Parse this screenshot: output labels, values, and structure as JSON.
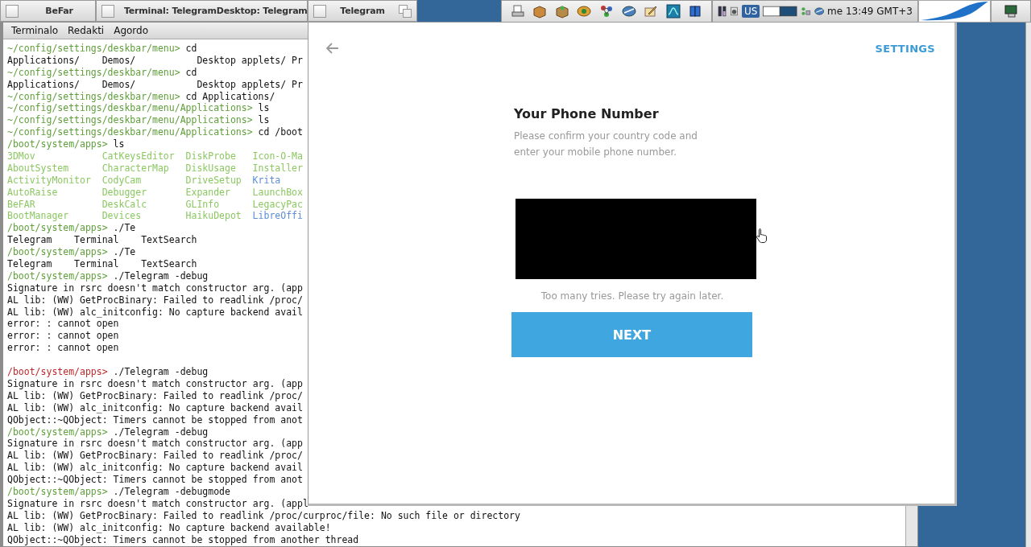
{
  "terminal": {
    "tabs": [
      {
        "title": "BeFar"
      },
      {
        "title": "Terminal: TelegramDesktop: Telegram"
      }
    ],
    "menu": [
      "Terminalo",
      "Redakti",
      "Agordo"
    ],
    "lines": [
      {
        "kind": "prompt",
        "prompt": "~/config/settings/deskbar/menu>",
        "command": "cd",
        "color": "#5f9f3a"
      },
      {
        "kind": "output",
        "text": "Applications/    Demos/           Desktop applets/ Pr"
      },
      {
        "kind": "prompt",
        "prompt": "~/config/settings/deskbar/menu>",
        "command": "cd",
        "color": "#5f9f3a"
      },
      {
        "kind": "output",
        "text": "Applications/    Demos/           Desktop applets/ Pr"
      },
      {
        "kind": "prompt",
        "prompt": "~/config/settings/deskbar/menu>",
        "command": "cd Applications/",
        "color": "#5f9f3a"
      },
      {
        "kind": "prompt",
        "prompt": "~/config/settings/deskbar/menu/Applications>",
        "command": "ls",
        "color": "#5f9f3a"
      },
      {
        "kind": "prompt",
        "prompt": "~/config/settings/deskbar/menu/Applications>",
        "command": "ls",
        "color": "#5f9f3a"
      },
      {
        "kind": "prompt",
        "prompt": "~/config/settings/deskbar/menu/Applications>",
        "command": "cd /boot",
        "color": "#5f9f3a"
      },
      {
        "kind": "prompt",
        "prompt": "/boot/system/apps>",
        "command": "ls",
        "color": "#5f9f3a"
      },
      {
        "kind": "listing",
        "entries": [
          {
            "text": "3DMov",
            "color": "#8cc862"
          },
          {
            "text": "CatKeysEditor",
            "color": "#8cc862"
          },
          {
            "text": "DiskProbe",
            "color": "#8cc862"
          },
          {
            "text": "Icon-O-Ma",
            "color": "#8cc862"
          }
        ]
      },
      {
        "kind": "listing",
        "entries": [
          {
            "text": "AboutSystem",
            "color": "#8cc862"
          },
          {
            "text": "CharacterMap",
            "color": "#8cc862"
          },
          {
            "text": "DiskUsage",
            "color": "#8cc862"
          },
          {
            "text": "Installer",
            "color": "#8cc862"
          }
        ]
      },
      {
        "kind": "listing",
        "entries": [
          {
            "text": "ActivityMonitor",
            "color": "#8cc862"
          },
          {
            "text": "CodyCam",
            "color": "#8cc862"
          },
          {
            "text": "DriveSetup",
            "color": "#8cc862"
          },
          {
            "text": "Krita",
            "color": "#5d8ed6"
          }
        ]
      },
      {
        "kind": "listing",
        "entries": [
          {
            "text": "AutoRaise",
            "color": "#8cc862"
          },
          {
            "text": "Debugger",
            "color": "#8cc862"
          },
          {
            "text": "Expander",
            "color": "#8cc862"
          },
          {
            "text": "LaunchBox",
            "color": "#8cc862"
          }
        ]
      },
      {
        "kind": "listing",
        "entries": [
          {
            "text": "BeFAR",
            "color": "#8cc862"
          },
          {
            "text": "DeskCalc",
            "color": "#8cc862"
          },
          {
            "text": "GLInfo",
            "color": "#8cc862"
          },
          {
            "text": "LegacyPac",
            "color": "#8cc862"
          }
        ]
      },
      {
        "kind": "listing",
        "entries": [
          {
            "text": "BootManager",
            "color": "#8cc862"
          },
          {
            "text": "Devices",
            "color": "#8cc862"
          },
          {
            "text": "HaikuDepot",
            "color": "#8cc862"
          },
          {
            "text": "LibreOffi",
            "color": "#5d8ed6"
          }
        ]
      },
      {
        "kind": "prompt",
        "prompt": "/boot/system/apps>",
        "command": "./Te",
        "color": "#5f9f3a"
      },
      {
        "kind": "output",
        "text": "Telegram    Terminal    TextSearch"
      },
      {
        "kind": "prompt",
        "prompt": "/boot/system/apps>",
        "command": "./Te",
        "color": "#5f9f3a"
      },
      {
        "kind": "output",
        "text": "Telegram    Terminal    TextSearch"
      },
      {
        "kind": "prompt",
        "prompt": "/boot/system/apps>",
        "command": "./Telegram -debug",
        "color": "#5f9f3a"
      },
      {
        "kind": "output",
        "text": "Signature in rsrc doesn't match constructor arg. (app"
      },
      {
        "kind": "output",
        "text": "AL lib: (WW) GetProcBinary: Failed to readlink /proc/"
      },
      {
        "kind": "output",
        "text": "AL lib: (WW) alc_initconfig: No capture backend avail"
      },
      {
        "kind": "output",
        "text": "error: : cannot open"
      },
      {
        "kind": "output",
        "text": "error: : cannot open"
      },
      {
        "kind": "output",
        "text": "error: : cannot open"
      },
      {
        "kind": "blank"
      },
      {
        "kind": "prompt",
        "prompt": "/boot/system/apps>",
        "command": "./Telegram -debug",
        "color": "#c0262a"
      },
      {
        "kind": "output",
        "text": "Signature in rsrc doesn't match constructor arg. (app"
      },
      {
        "kind": "output",
        "text": "AL lib: (WW) GetProcBinary: Failed to readlink /proc/"
      },
      {
        "kind": "output",
        "text": "AL lib: (WW) alc_initconfig: No capture backend avail"
      },
      {
        "kind": "output",
        "text": "QObject::~QObject: Timers cannot be stopped from anot"
      },
      {
        "kind": "prompt",
        "prompt": "/boot/system/apps>",
        "command": "./Telegram -debug",
        "color": "#5f9f3a"
      },
      {
        "kind": "output",
        "text": "Signature in rsrc doesn't match constructor arg. (app"
      },
      {
        "kind": "output",
        "text": "AL lib: (WW) GetProcBinary: Failed to readlink /proc/"
      },
      {
        "kind": "output",
        "text": "AL lib: (WW) alc_initconfig: No capture backend avail"
      },
      {
        "kind": "output",
        "text": "QObject::~QObject: Timers cannot be stopped from anot"
      },
      {
        "kind": "prompt",
        "prompt": "/boot/system/apps>",
        "command": "./Telegram -debugmode",
        "color": "#5f9f3a"
      },
      {
        "kind": "output",
        "text": "Signature in rsrc doesn't match constructor arg. (appl"
      },
      {
        "kind": "output",
        "text": "AL lib: (WW) GetProcBinary: Failed to readlink /proc/curproc/file: No such file or directory"
      },
      {
        "kind": "output",
        "text": "AL lib: (WW) alc_initconfig: No capture backend available!"
      },
      {
        "kind": "output",
        "text": "QObject::~QObject: Timers cannot be stopped from another thread"
      }
    ]
  },
  "telegram": {
    "tab_title": "Telegram",
    "settings": "SETTINGS",
    "title": "Your Phone Number",
    "description": "Please confirm your country code and enter your mobile phone number.",
    "error": "Too many tries. Please try again later.",
    "button": "NEXT"
  },
  "deskbar": {
    "keymap": "US",
    "clock": "me 13:49 GMT+3"
  }
}
